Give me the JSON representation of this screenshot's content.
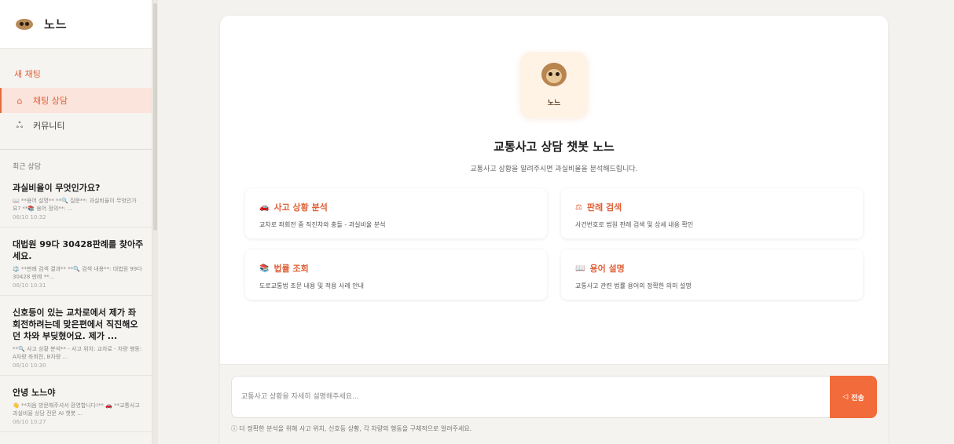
{
  "app": {
    "title": "노느"
  },
  "sidebar": {
    "new_chat": "새 채팅",
    "nav": [
      {
        "label": "채팅 상담",
        "icon": "home-icon",
        "active": true
      },
      {
        "label": "커뮤니티",
        "icon": "users-icon",
        "active": false
      }
    ],
    "recent_label": "최근 상담",
    "recent": [
      {
        "title": "과실비율이 무엇인가요?",
        "preview": "📖 **용어 설명** **🔍 질문**: 과실비율이 무엇인가요? **📚 용어 정의**: ...",
        "time": "06/10 10:32"
      },
      {
        "title": "대법원 99다 30428판례를 찾아주세요.",
        "preview": "⚖️ **판례 검색 결과** **🔍 검색 내용**: 대법원 99다 30428 판례 **...",
        "time": "06/10 10:31"
      },
      {
        "title": "신호등이 있는 교차로에서 제가 좌회전하려는데 맞은편에서 직진해오던 차와 부딪혔어요. 제가 ...",
        "preview": "**🔍 사고 상황 분석** - 사고 위치: 교차로 - 차량 행동: A차량 좌회전, B차량 ...",
        "time": "06/10 10:30"
      },
      {
        "title": "안녕 노느야",
        "preview": "👋 **처음 방문해주셔서 환영합니다!** 🚗 **교통사고 과실비율 상담 전문 AI 챗봇 ...",
        "time": "06/10 10:27"
      }
    ]
  },
  "main": {
    "mascot_label": "노느",
    "title": "교통사고 상담 챗봇 노느",
    "subtitle": "교통사고 상황을 알려주시면 과실비율을 분석해드립니다.",
    "features": [
      {
        "icon": "🚗",
        "icon_name": "car-icon",
        "title": "사고 상황 분석",
        "desc": "교차로 좌회전 중 직진차와 충돌 - 과실비율 분석"
      },
      {
        "icon": "⚖",
        "icon_name": "scale-icon",
        "title": "판례 검색",
        "desc": "사건번호로 법원 판례 검색 및 상세 내용 확인"
      },
      {
        "icon": "📚",
        "icon_name": "books-icon",
        "title": "법률 조회",
        "desc": "도로교통법 조문 내용 및 적용 사례 안내"
      },
      {
        "icon": "📖",
        "icon_name": "book-icon",
        "title": "용어 설명",
        "desc": "교통사고 관련 법률 용어의 정확한 의미 설명"
      }
    ],
    "input_placeholder": "교통사고 상황을 자세히 설명해주세요...",
    "send_label": "전송",
    "hint": "ⓘ 더 정확한 분석을 위해 사고 위치, 신호등 상황, 각 차량의 행동을 구체적으로 알려주세요."
  },
  "colors": {
    "accent": "#f26b3a",
    "accent_text": "#e0623a",
    "active_bg": "#fbe4dc"
  }
}
